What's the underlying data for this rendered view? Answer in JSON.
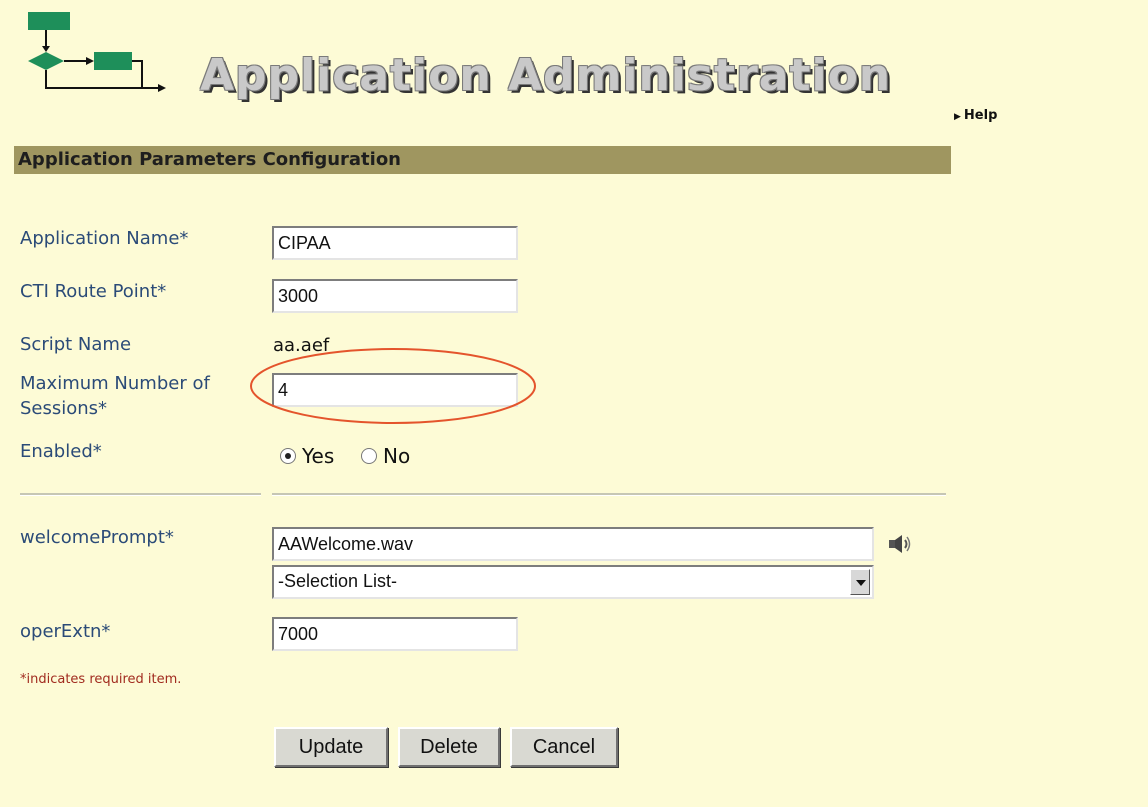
{
  "header": {
    "title": "Application Administration",
    "help_label": "Help"
  },
  "section": {
    "title": "Application Parameters Configuration"
  },
  "form": {
    "application_name": {
      "label": "Application Name*",
      "value": "CIPAA"
    },
    "cti_route_point": {
      "label": "CTI Route Point*",
      "value": "3000"
    },
    "script_name": {
      "label": "Script Name",
      "value": "aa.aef"
    },
    "max_sessions": {
      "label_line1": "Maximum Number of",
      "label_line2": "Sessions*",
      "value": "4"
    },
    "enabled": {
      "label": "Enabled*",
      "yes_label": "Yes",
      "no_label": "No",
      "selected": "Yes"
    },
    "welcome_prompt": {
      "label": "welcomePrompt*",
      "value": "AAWelcome.wav",
      "select_value": "-Selection List-"
    },
    "oper_extn": {
      "label": "operExtn*",
      "value": "7000"
    },
    "required_note": "*indicates required item."
  },
  "buttons": {
    "update": "Update",
    "delete": "Delete",
    "cancel": "Cancel"
  },
  "colors": {
    "background": "#fdfbd6",
    "section_bar": "#9f9660",
    "label_text": "#2b4b78",
    "highlight_ellipse": "#e4542c",
    "logo_green": "#1e8f5a"
  },
  "icons": {
    "logo": "workflow-logo-icon",
    "help": "triangle-right-icon",
    "speaker": "speaker-icon",
    "dropdown": "chevron-down-icon"
  }
}
